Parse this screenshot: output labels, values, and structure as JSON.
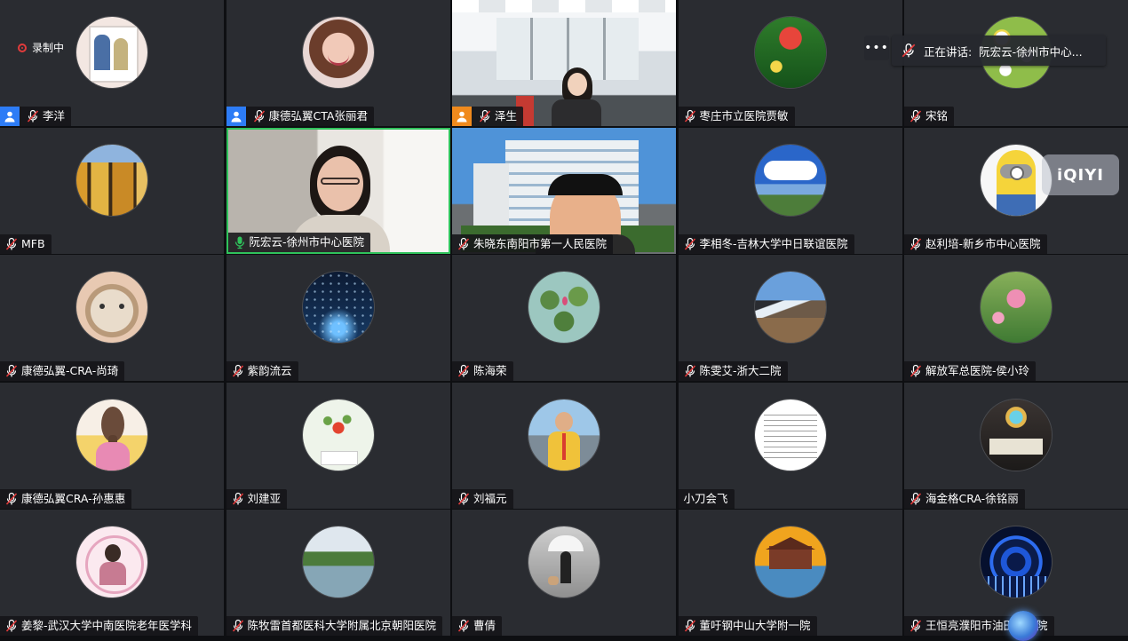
{
  "recording": {
    "label": "录制中"
  },
  "speaking": {
    "label": "正在讲话:  阮宏云-徐州市中心..."
  },
  "more": {
    "label": "•••"
  },
  "watermark": {
    "label": "iQIYI"
  },
  "colors": {
    "active_border": "#2fc25b",
    "host_blue": "#2d7cf6",
    "cohost_orange": "#f08a1d",
    "rec_red": "#e23b3b"
  },
  "participants": [
    {
      "name": "李洋",
      "role": "host",
      "mic": "muted",
      "avatar": "poster"
    },
    {
      "name": "康德弘翼CTA张丽君",
      "role": "host",
      "mic": "muted",
      "avatar": "girl"
    },
    {
      "name": "泽生",
      "role": "cohost",
      "mic": "muted",
      "avatar": "office-video"
    },
    {
      "name": "枣庄市立医院贾敏",
      "role": "",
      "mic": "muted",
      "avatar": "garden"
    },
    {
      "name": "宋铭",
      "role": "",
      "mic": "muted",
      "avatar": "daisies"
    },
    {
      "name": "MFB",
      "role": "",
      "mic": "muted",
      "avatar": "autumn-trees"
    },
    {
      "name": "阮宏云-徐州市中心医院",
      "role": "",
      "mic": "speaking",
      "avatar": "woman-video"
    },
    {
      "name": "朱晓东南阳市第一人民医院",
      "role": "",
      "mic": "muted",
      "avatar": "hospital-video"
    },
    {
      "name": "李相冬-吉林大学中日联谊医院",
      "role": "",
      "mic": "muted",
      "avatar": "sky"
    },
    {
      "name": "赵利培-新乡市中心医院",
      "role": "",
      "mic": "muted",
      "avatar": "minion"
    },
    {
      "name": "康德弘翼-CRA-尚琦",
      "role": "",
      "mic": "muted",
      "avatar": "cat"
    },
    {
      "name": "紫韵流云",
      "role": "",
      "mic": "muted",
      "avatar": "night-road"
    },
    {
      "name": "陈海荣",
      "role": "",
      "mic": "muted",
      "avatar": "lotus-leaves"
    },
    {
      "name": "陈雯艾-浙大二院",
      "role": "",
      "mic": "muted",
      "avatar": "mountains"
    },
    {
      "name": "解放军总医院-侯小玲",
      "role": "",
      "mic": "muted",
      "avatar": "pink-flower"
    },
    {
      "name": "康德弘翼CRA-孙惠惠",
      "role": "",
      "mic": "muted",
      "avatar": "braid"
    },
    {
      "name": "刘建亚",
      "role": "",
      "mic": "muted",
      "avatar": "red-flower"
    },
    {
      "name": "刘福元",
      "role": "",
      "mic": "muted",
      "avatar": "man-harbor"
    },
    {
      "name": "小刀会飞",
      "role": "",
      "mic": "none",
      "avatar": "text-page"
    },
    {
      "name": "海金格CRA-徐铭丽",
      "role": "",
      "mic": "muted",
      "avatar": "dark-crowd"
    },
    {
      "name": "姜黎-武汉大学中南医院老年医学科",
      "role": "",
      "mic": "muted",
      "avatar": "woman-frame"
    },
    {
      "name": "陈牧雷首都医科大学附属北京朝阳医院",
      "role": "",
      "mic": "muted",
      "avatar": "lake"
    },
    {
      "name": "曹倩",
      "role": "",
      "mic": "muted",
      "avatar": "umbrella"
    },
    {
      "name": "董吁钢中山大学附一院",
      "role": "",
      "mic": "muted",
      "avatar": "cabin"
    },
    {
      "name": "王恒亮濮阳市油田总医院",
      "role": "",
      "mic": "muted",
      "avatar": "tunnel"
    }
  ]
}
